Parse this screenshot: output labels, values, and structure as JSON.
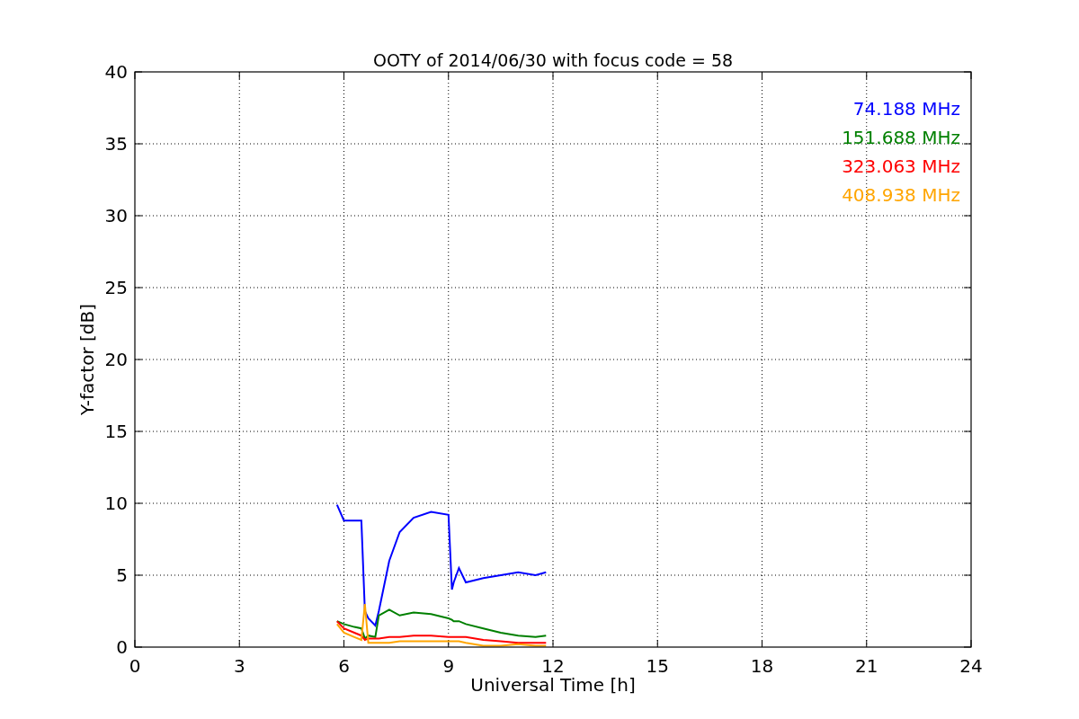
{
  "figure": {
    "chart_data": {
      "type": "line",
      "title": "OOTY of 2014/06/30 with focus code = 58",
      "xlabel": "Universal Time [h]",
      "ylabel": "Y-factor [dB]",
      "x": [
        5.8,
        6.0,
        6.3,
        6.5,
        6.6,
        6.7,
        6.9,
        7.0,
        7.3,
        7.6,
        8.0,
        8.5,
        9.0,
        9.1,
        9.15,
        9.3,
        9.5,
        10.0,
        10.5,
        11.0,
        11.5,
        11.8
      ],
      "series": [
        {
          "name": "74.188 MHz",
          "color": "#0000ff",
          "values": [
            9.9,
            8.8,
            8.8,
            8.8,
            2.5,
            2.0,
            1.5,
            2.5,
            6.0,
            8.0,
            9.0,
            9.4,
            9.2,
            4.0,
            4.5,
            5.5,
            4.5,
            4.8,
            5.0,
            5.2,
            5.0,
            5.2
          ]
        },
        {
          "name": "151.688 MHz",
          "color": "#008000",
          "values": [
            1.8,
            1.6,
            1.4,
            1.3,
            0.6,
            0.8,
            0.7,
            2.2,
            2.6,
            2.2,
            2.4,
            2.3,
            2.0,
            1.9,
            1.8,
            1.8,
            1.6,
            1.3,
            1.0,
            0.8,
            0.7,
            0.8
          ]
        },
        {
          "name": "323.063 MHz",
          "color": "#ff0000",
          "values": [
            1.8,
            1.3,
            1.0,
            0.8,
            0.5,
            0.6,
            0.6,
            0.6,
            0.7,
            0.7,
            0.8,
            0.8,
            0.7,
            0.7,
            0.7,
            0.7,
            0.7,
            0.5,
            0.4,
            0.3,
            0.3,
            0.3
          ]
        },
        {
          "name": "408.938 MHz",
          "color": "#ffa500",
          "values": [
            1.6,
            1.0,
            0.7,
            0.5,
            3.0,
            0.3,
            0.3,
            0.3,
            0.3,
            0.4,
            0.4,
            0.4,
            0.4,
            0.4,
            0.4,
            0.4,
            0.3,
            0.1,
            0.1,
            0.2,
            0.1,
            0.1
          ]
        }
      ],
      "grid": true,
      "xlim": [
        0,
        24
      ],
      "ylim": [
        0,
        40
      ],
      "xticks": [
        0,
        3,
        6,
        9,
        12,
        15,
        18,
        21,
        24
      ],
      "yticks": [
        0,
        5,
        10,
        15,
        20,
        25,
        30,
        35,
        40
      ]
    }
  }
}
